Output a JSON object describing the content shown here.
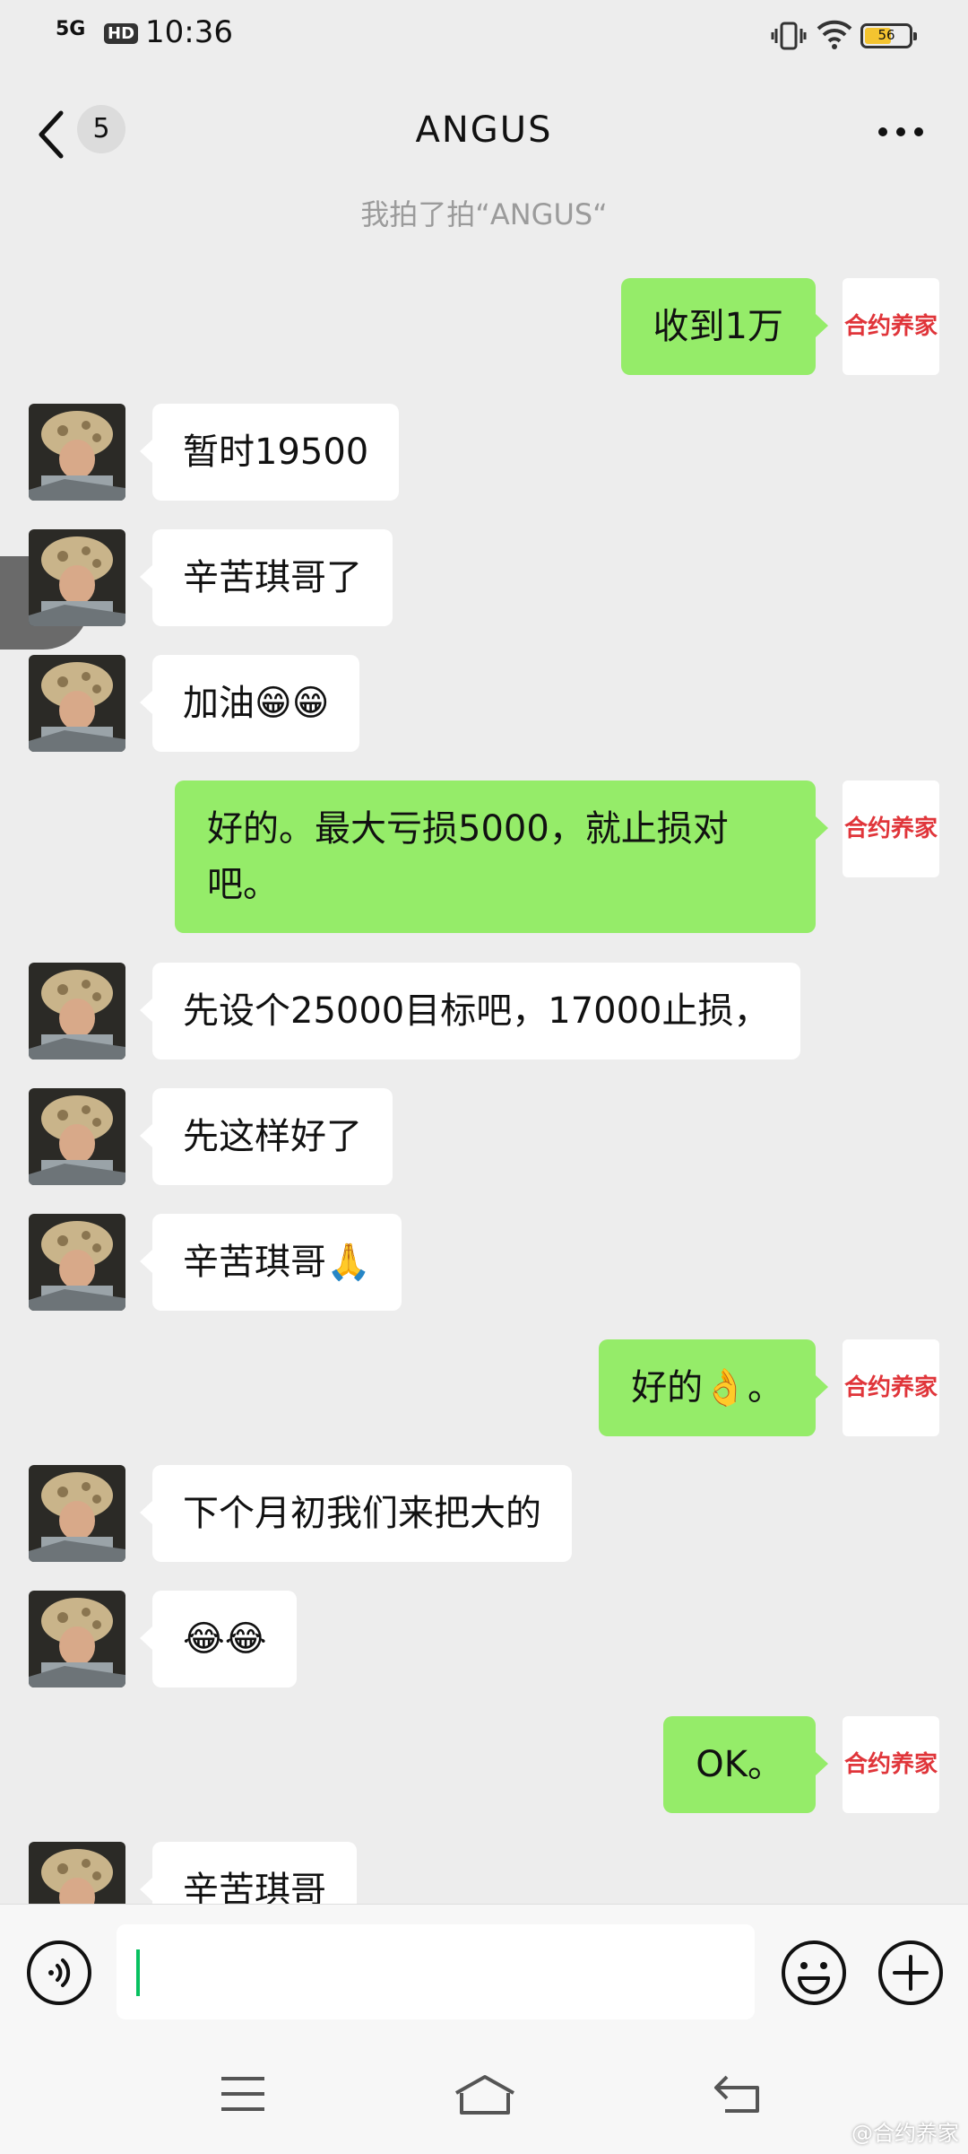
{
  "status_bar": {
    "network": "5G",
    "hd_badge": "HD",
    "time": "10:36",
    "battery": "56"
  },
  "header": {
    "back_count": "5",
    "title": "ANGUS"
  },
  "system_message": "我拍了拍“ANGUS“",
  "self_avatar_label": "合约养家",
  "messages": [
    {
      "from": "me",
      "text": "收到1万"
    },
    {
      "from": "contact",
      "text": "暂时19500"
    },
    {
      "from": "contact",
      "text": "辛苦琪哥了"
    },
    {
      "from": "contact",
      "text": "加油😁😁"
    },
    {
      "from": "me",
      "text": "好的。最大亏损5000，就止损对吧。"
    },
    {
      "from": "contact",
      "text": "先设个25000目标吧，17000止损，"
    },
    {
      "from": "contact",
      "text": "先这样好了"
    },
    {
      "from": "contact",
      "text": "辛苦琪哥🙏"
    },
    {
      "from": "me",
      "text": "好的👌。"
    },
    {
      "from": "contact",
      "text": "下个月初我们来把大的"
    },
    {
      "from": "contact",
      "text": "😂😂"
    },
    {
      "from": "me",
      "text": "OK。"
    },
    {
      "from": "contact",
      "text": "辛苦琪哥"
    }
  ],
  "watermark": "@合约养家",
  "icons": [
    "back-icon",
    "more-icon",
    "voice-icon",
    "emoji-icon",
    "plus-icon",
    "menu-icon",
    "home-icon",
    "return-icon"
  ]
}
